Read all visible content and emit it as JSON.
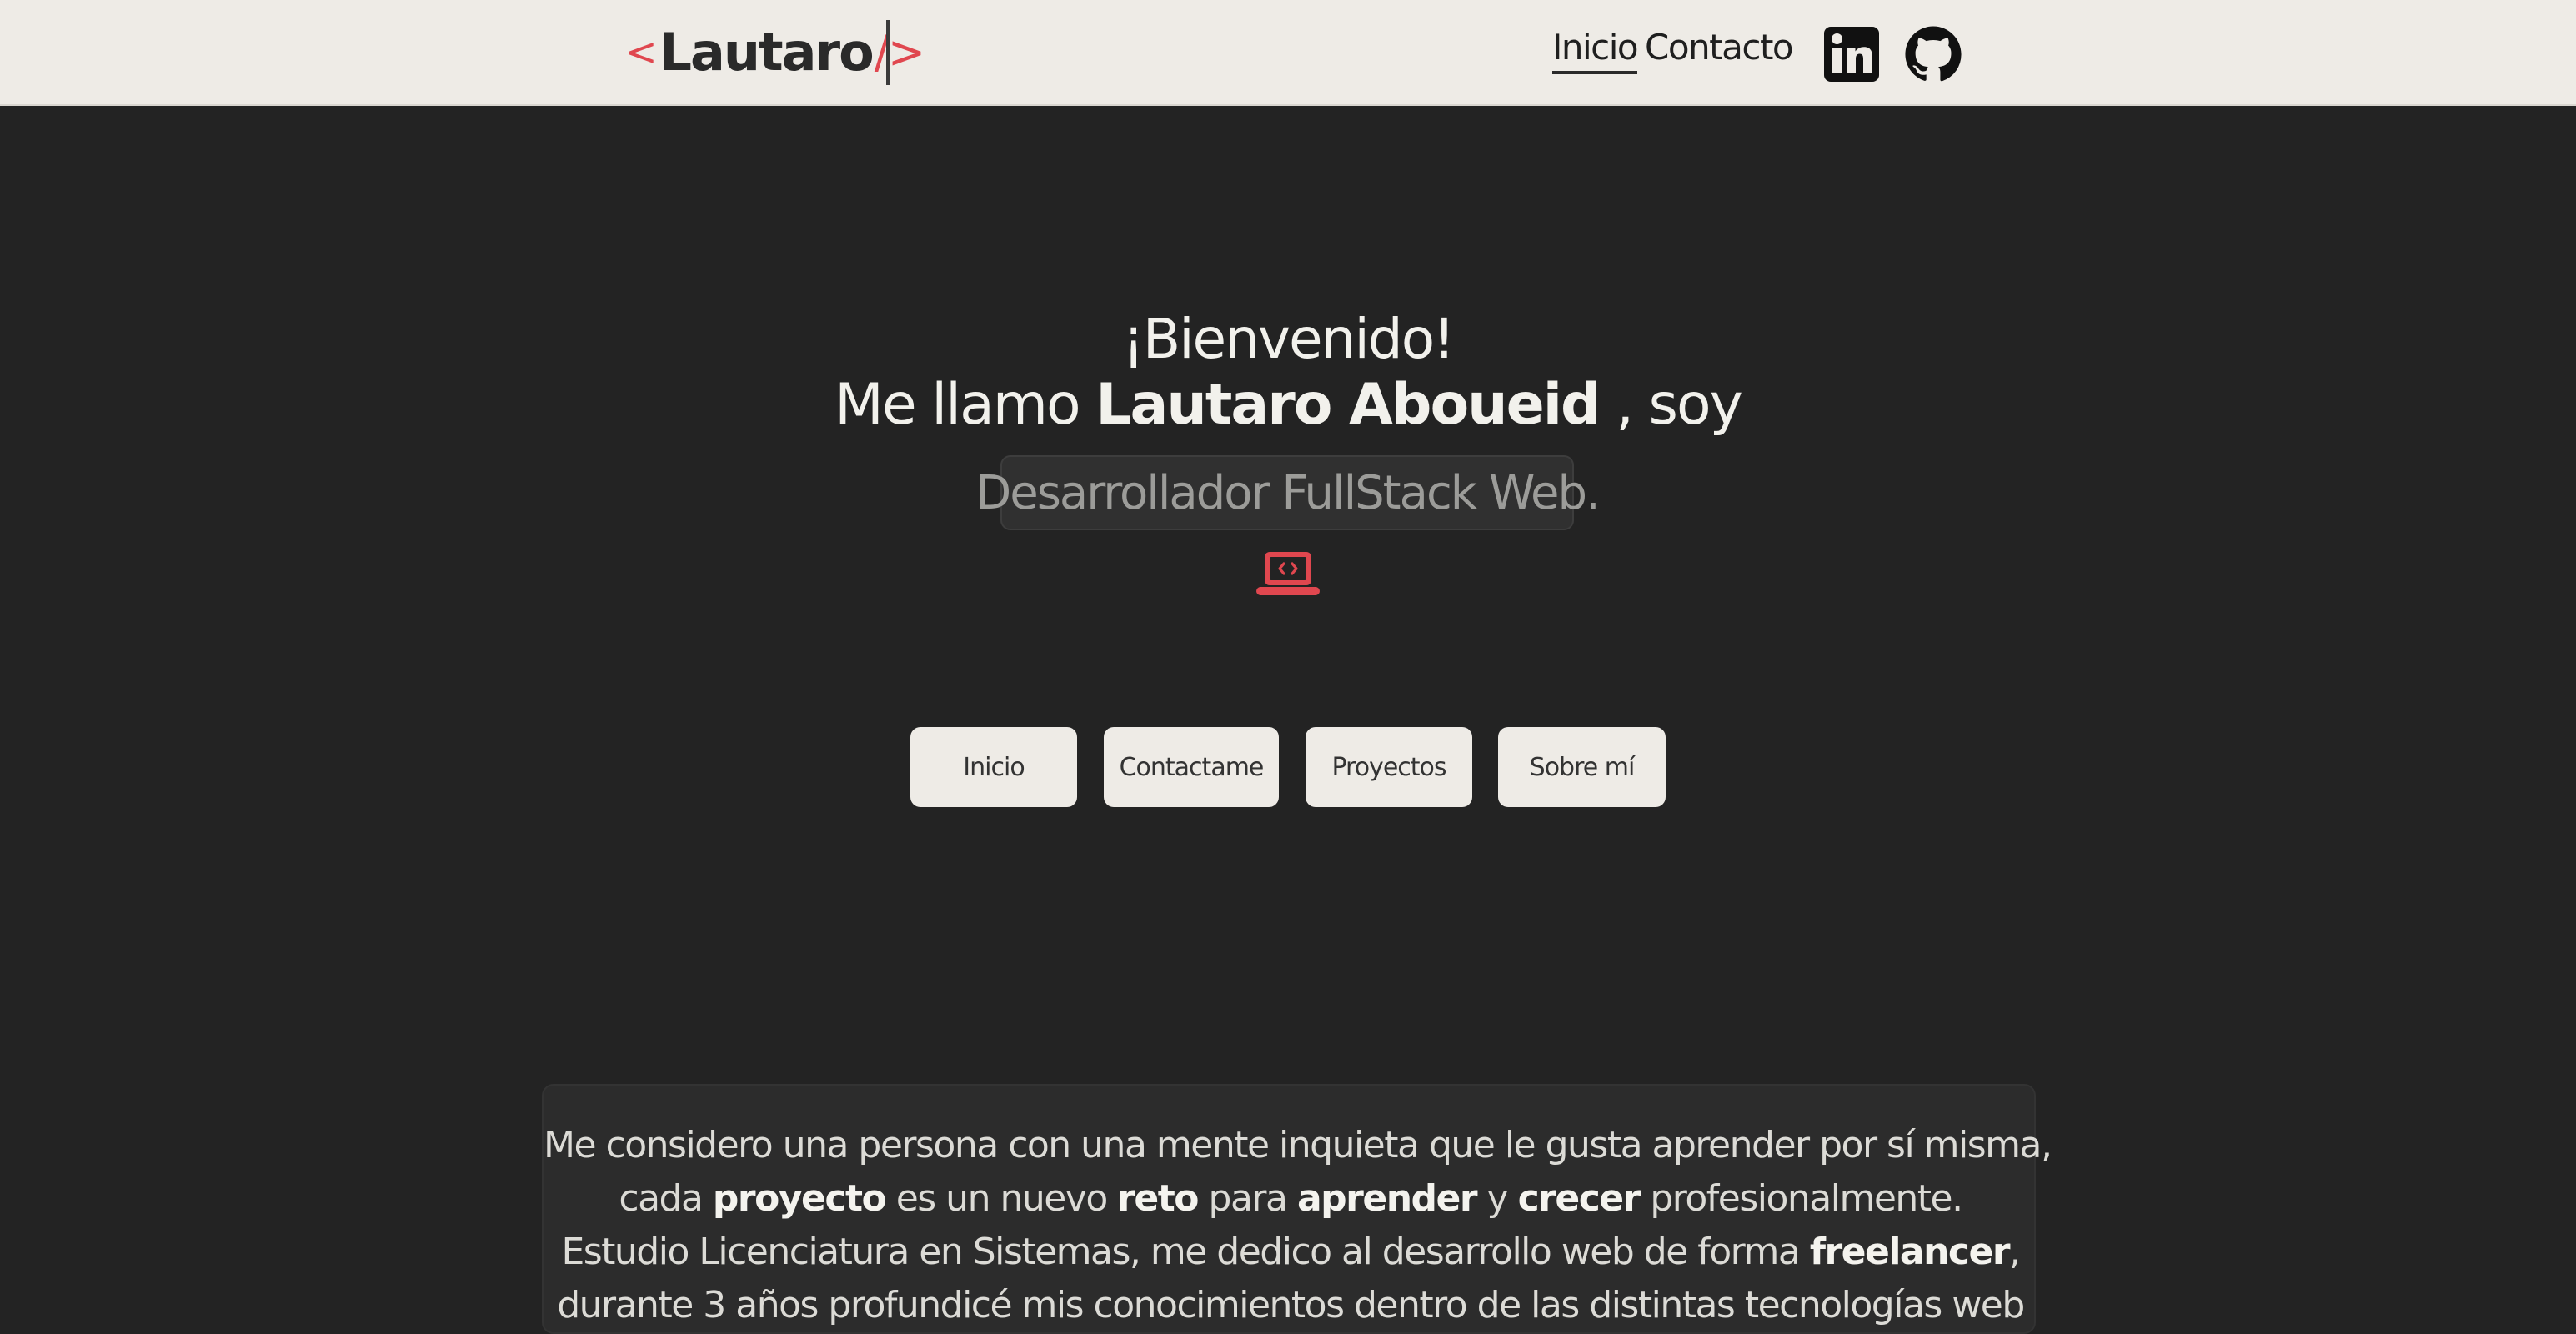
{
  "header": {
    "logo": {
      "open_bracket": "<",
      "name": "Lautaro",
      "close_bracket": "/>"
    },
    "nav": [
      {
        "label": "Inicio",
        "active": true
      },
      {
        "label": "Contacto",
        "active": false
      }
    ],
    "social_icons": [
      "linkedin-icon",
      "github-icon"
    ]
  },
  "hero": {
    "welcome": "¡Bienvenido!",
    "intro_prefix": "Me llamo ",
    "intro_name": "Lautaro Aboueid",
    "intro_suffix": " , soy",
    "role": "Desarrollador FullStack Web.",
    "icon": "laptop-code-icon"
  },
  "buttons": [
    "Inicio",
    "Contactame",
    "Proyectos",
    "Sobre mí"
  ],
  "about": {
    "line1": "Me considero una persona con una mente inquieta que le gusta aprender por sí misma,",
    "line2": {
      "p1": "cada ",
      "b1": "proyecto",
      "p2": " es un nuevo ",
      "b2": "reto",
      "p3": " para ",
      "b3": "aprender",
      "p4": " y ",
      "b4": "crecer",
      "p5": " profesionalmente."
    },
    "line3": {
      "p1": "Estudio Licenciatura en Sistemas, me dedico al desarrollo web de forma ",
      "b1": "freelancer",
      "p2": ","
    },
    "line4": "durante 3 años profundicé mis conocimientos dentro de las distintas tecnologías web"
  },
  "colors": {
    "background": "#232323",
    "header_bg": "#eeebe6",
    "accent": "#e0474f",
    "button_bg": "#eeebe6",
    "role_text": "#9c9c99"
  }
}
